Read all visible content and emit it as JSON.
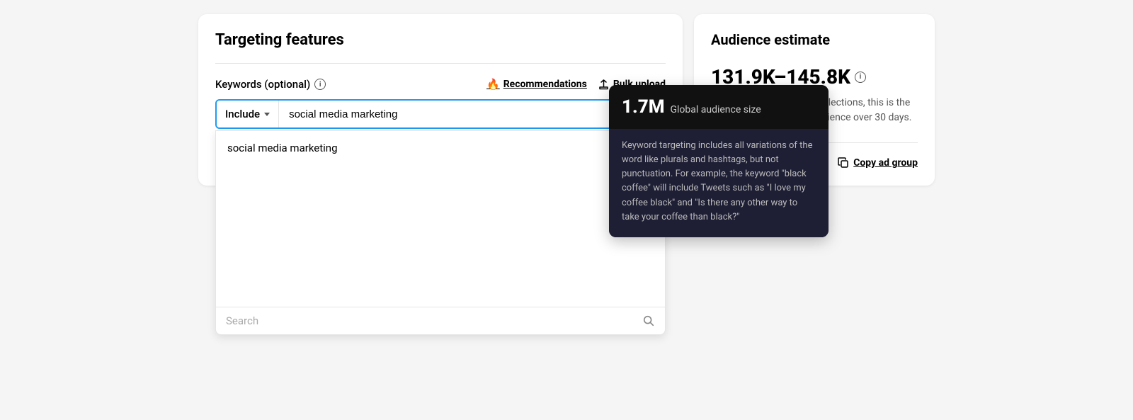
{
  "left": {
    "title": "Targeting features",
    "keywords_label": "Keywords (optional)",
    "recommendations_label": "Recommendations",
    "bulk_upload_label": "Bulk upload",
    "include_label": "Include",
    "input_value": "social media marketing",
    "suggestion": "social media marketing",
    "search_placeholder": "Search"
  },
  "tooltip": {
    "stat": "1.7M",
    "stat_label": "Global audience size",
    "body": "Keyword targeting includes all variations of the word like plurals and hashtags, but not punctuation. For example, the keyword \"black coffee\" will include Tweets such as \"I love my coffee black\" and \"Is there any other way to take your coffee than black?\""
  },
  "right": {
    "title": "Audience estimate",
    "range": "131.9K–145.8K",
    "description": "Based on your targeting selections, this is the estimated size of your audience over 30 days.",
    "copy_ad_group_label": "Copy ad group"
  },
  "icons": {
    "info": "i",
    "checkmark": "✓",
    "search": "search-icon"
  }
}
